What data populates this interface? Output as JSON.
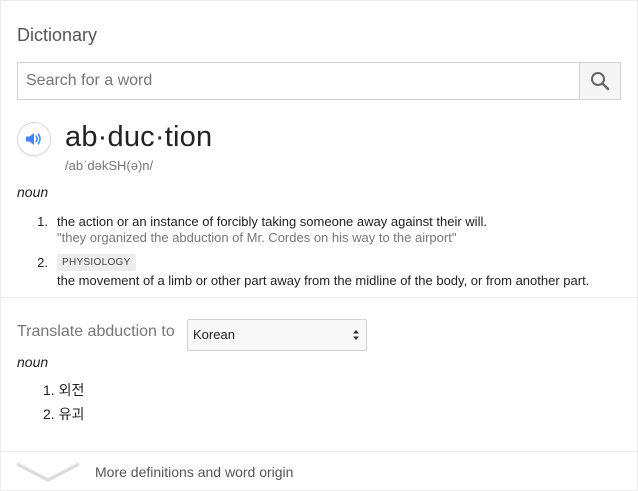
{
  "header": {
    "title": "Dictionary"
  },
  "search": {
    "placeholder": "Search for a word",
    "value": ""
  },
  "entry": {
    "headword": "ab·duc·tion",
    "phonetic": "/abˈdəkSH(ə)n/",
    "part_of_speech": "noun",
    "definitions": [
      {
        "number": "1.",
        "text": "the action or an instance of forcibly taking someone away against their will.",
        "example": "\"they organized the abduction of Mr. Cordes on his way to the airport\""
      },
      {
        "number": "2.",
        "tag": "PHYSIOLOGY",
        "text": "the movement of a limb or other part away from the midline of the body, or from another part."
      }
    ]
  },
  "translate": {
    "label": "Translate abduction to",
    "language": "Korean",
    "part_of_speech": "noun",
    "items": [
      {
        "number": "1.",
        "text": "외전"
      },
      {
        "number": "2.",
        "text": "유괴"
      }
    ]
  },
  "footer": {
    "more_label": "More definitions and word origin"
  },
  "colors": {
    "accent": "#4285f4",
    "secondary_text": "#777777",
    "tag_bg": "#ededed"
  }
}
